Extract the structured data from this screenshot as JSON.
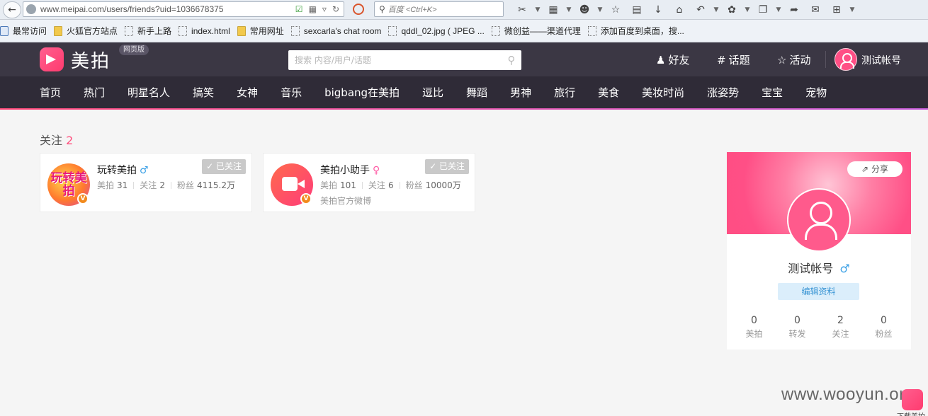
{
  "browser": {
    "url": "www.meipai.com/users/friends?uid=1036678375",
    "search_placeholder": "百度 <Ctrl+K>",
    "bookmarks": [
      {
        "label": "最常访问",
        "kind": "first"
      },
      {
        "label": "火狐官方站点",
        "kind": "folder"
      },
      {
        "label": "新手上路",
        "kind": "page"
      },
      {
        "label": "index.html",
        "kind": "page"
      },
      {
        "label": "常用网址",
        "kind": "folder"
      },
      {
        "label": "sexcarla's chat room",
        "kind": "page"
      },
      {
        "label": "qddl_02.jpg ( JPEG ...",
        "kind": "page"
      },
      {
        "label": "微创益——渠道代理",
        "kind": "page"
      },
      {
        "label": "添加百度到桌面，搜...",
        "kind": "page"
      }
    ]
  },
  "site": {
    "logo_text": "美拍",
    "web_badge": "网页版",
    "search_placeholder": "搜索 内容/用户/话题",
    "links": {
      "friends": "好友",
      "topics": "话题",
      "events": "活动"
    },
    "username": "测试帐号"
  },
  "categories": [
    "首页",
    "热门",
    "明星名人",
    "搞笑",
    "女神",
    "音乐",
    "bigbang在美拍",
    "逗比",
    "舞蹈",
    "男神",
    "旅行",
    "美食",
    "美妆时尚",
    "涨姿势",
    "宝宝",
    "宠物"
  ],
  "follow": {
    "label": "关注",
    "count": "2",
    "users": [
      {
        "name": "玩转美拍",
        "gender": "♂",
        "avatar_text": "玩转美拍",
        "followed_label": "已关注",
        "meipai_label": "美拍",
        "meipai": "31",
        "follow_label": "关注",
        "follow": "2",
        "fans_label": "粉丝",
        "fans": "4115.2万",
        "desc": ""
      },
      {
        "name": "美拍小助手",
        "gender": "♀",
        "avatar_text": "",
        "followed_label": "已关注",
        "meipai_label": "美拍",
        "meipai": "101",
        "follow_label": "关注",
        "follow": "6",
        "fans_label": "粉丝",
        "fans": "10000万",
        "desc": "美拍官方微博"
      }
    ]
  },
  "profile": {
    "share_label": "分享",
    "name": "测试帐号",
    "gender": "♂",
    "edit_label": "编辑资料",
    "stats": [
      {
        "value": "0",
        "label": "美拍"
      },
      {
        "value": "0",
        "label": "转发"
      },
      {
        "value": "2",
        "label": "关注"
      },
      {
        "value": "0",
        "label": "粉丝"
      }
    ]
  },
  "watermark": "www.wooyun.org",
  "download_label": "下载美拍",
  "colors": {
    "accent": "#ff4f7e",
    "header_bg": "#3b3744",
    "nav_bg": "#2f2b37",
    "male": "#3aa0e6",
    "female": "#ff5aa5"
  }
}
